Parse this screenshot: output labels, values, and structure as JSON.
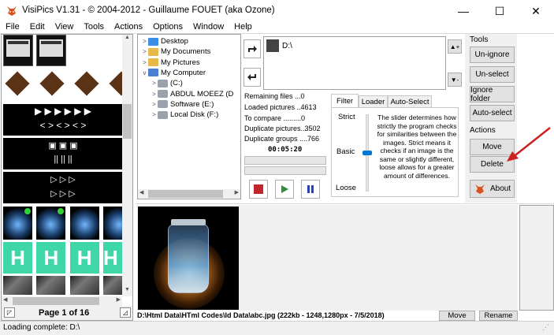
{
  "window": {
    "title": "VisiPics V1.31 - © 2004-2012 - Guillaume FOUET (aka Ozone)",
    "minimize": "—",
    "maximize": "☐",
    "close": "✕"
  },
  "menu": [
    "File",
    "Edit",
    "View",
    "Tools",
    "Actions",
    "Options",
    "Window",
    "Help"
  ],
  "thumbnails": {
    "pager": "Page 1 of 16",
    "prev_icon": "page-prev-icon",
    "next_icon": "page-next-icon"
  },
  "tree": {
    "items": [
      {
        "label": "Desktop",
        "indent": 0,
        "expander": ">",
        "icon": "desktop-icon"
      },
      {
        "label": "My Documents",
        "indent": 0,
        "expander": ">",
        "icon": "documents-icon"
      },
      {
        "label": "My Pictures",
        "indent": 0,
        "expander": ">",
        "icon": "pictures-icon"
      },
      {
        "label": "My Computer",
        "indent": 0,
        "expander": "v",
        "icon": "computer-icon"
      },
      {
        "label": "(C:)",
        "indent": 1,
        "expander": ">",
        "icon": "drive-icon"
      },
      {
        "label": "ABDUL MOEEZ (D",
        "indent": 1,
        "expander": ">",
        "icon": "drive-icon"
      },
      {
        "label": "Software (E:)",
        "indent": 1,
        "expander": ">",
        "icon": "drive-icon"
      },
      {
        "label": "Local Disk (F:)",
        "indent": 1,
        "expander": ">",
        "icon": "drive-icon"
      }
    ]
  },
  "folders": {
    "selected": "D:\\"
  },
  "stats": {
    "remaining": "Remaining files ...0",
    "loaded": "Loaded pictures ..4613",
    "to_compare": "To compare .........0",
    "duplicates": "Duplicate pictures..3502",
    "groups": "Duplicate groups ....766",
    "timer": "00:05:20"
  },
  "tabs": [
    "Filter",
    "Loader",
    "Auto-Select"
  ],
  "filter": {
    "strict": "Strict",
    "basic": "Basic",
    "loose": "Loose",
    "description": "The slider determines how strictly the program checks for similarities between the images. Strict means it checks if an image is the same or slightly different, loose allows for a greater amount of differences.",
    "slider_level": 0.5
  },
  "tools": {
    "title": "Tools",
    "unignore": "Un-ignore",
    "unselect": "Un-select",
    "ignore_folder": "Ignore folder",
    "auto_select": "Auto-select"
  },
  "actions": {
    "title": "Actions",
    "move": "Move",
    "delete": "Delete",
    "about": "About"
  },
  "preview": {
    "file_info": "D:\\Html Data\\HTml Codes\\Id Data\\abc.jpg (222kb - 1248,1280px - 7/5/2018)",
    "move": "Move",
    "rename": "Rename"
  },
  "statusbar": {
    "text": "Loading complete: D:\\"
  },
  "colors": {
    "accent_red": "#cc2222",
    "face": "#f0f0f0",
    "border": "#a0a0a0"
  }
}
